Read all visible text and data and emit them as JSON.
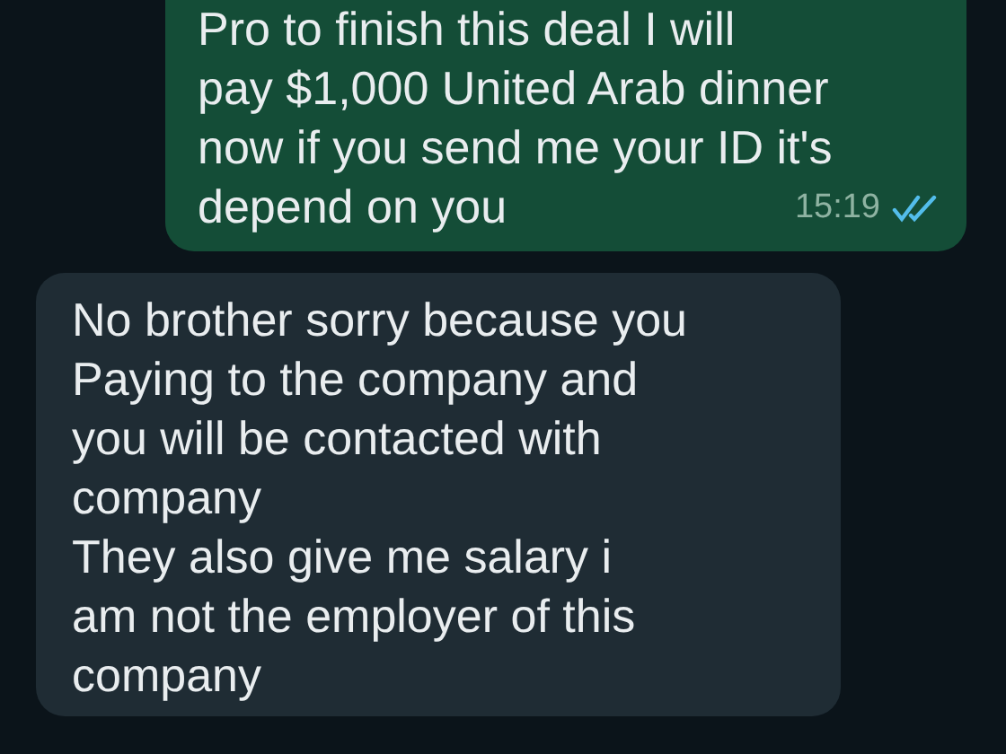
{
  "messages": [
    {
      "kind": "outgoing",
      "lines": [
        "Pro to finish this deal I will",
        "pay $1,000 United Arab dinner",
        "now if you send me your ID it's",
        "depend on you"
      ],
      "time": "15:19",
      "read": true
    },
    {
      "kind": "incoming",
      "lines": [
        "No brother sorry because you",
        "Paying to the company and",
        "you will be contacted with",
        "company",
        "They also give me salary i",
        "am not the employer of this",
        "company"
      ]
    }
  ]
}
